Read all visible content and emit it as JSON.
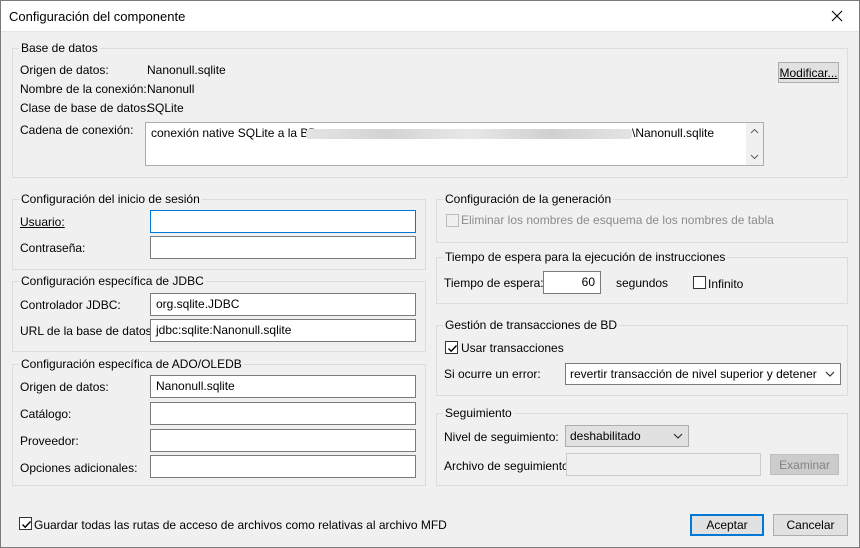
{
  "window": {
    "title": "Configuración del componente"
  },
  "db": {
    "legend": "Base de datos",
    "origin_label": "Origen de datos:",
    "origin_value": "Nanonull.sqlite",
    "conn_name_label": "Nombre de la conexión:",
    "conn_name_value": "Nanonull",
    "class_label": "Clase de base de datos:",
    "class_value": "SQLite",
    "conn_string_label": "Cadena de conexión:",
    "conn_string_prefix": "conexión native SQLite a la BD",
    "conn_string_suffix": "\\Nanonull.sqlite",
    "modify_button": "Modificar..."
  },
  "login": {
    "legend": "Configuración del inicio de sesión",
    "user_label": "Usuario:",
    "user_value": "",
    "password_label": "Contraseña:",
    "password_value": ""
  },
  "jdbc": {
    "legend": "Configuración específica de JDBC",
    "driver_label": "Controlador JDBC:",
    "driver_value": "org.sqlite.JDBC",
    "url_label": "URL de la base de datos:",
    "url_value": "jdbc:sqlite:Nanonull.sqlite"
  },
  "ado": {
    "legend": "Configuración específica de ADO/OLEDB",
    "origin_label": "Origen de datos:",
    "origin_value": "Nanonull.sqlite",
    "catalog_label": "Catálogo:",
    "catalog_value": "",
    "provider_label": "Proveedor:",
    "provider_value": "",
    "extra_label": "Opciones adicionales:",
    "extra_value": ""
  },
  "generation": {
    "legend": "Configuración de la generación",
    "strip_schema_label": "Eliminar los nombres de esquema de los nombres de tabla",
    "strip_schema_checked": false
  },
  "timeout": {
    "legend": "Tiempo de espera para la ejecución de instrucciones",
    "label": "Tiempo de espera:",
    "value": "60",
    "unit": "segundos",
    "infinite_label": "Infinito",
    "infinite_checked": false
  },
  "transactions": {
    "legend": "Gestión de transacciones de BD",
    "use_label": "Usar transacciones",
    "use_checked": true,
    "on_error_label": "Si ocurre un error:",
    "on_error_value": "revertir transacción de nivel superior y detener"
  },
  "trace": {
    "legend": "Seguimiento",
    "level_label": "Nivel de seguimiento:",
    "level_value": "deshabilitado",
    "file_label": "Archivo de seguimiento:",
    "file_value": "",
    "browse_button": "Examinar"
  },
  "footer": {
    "relative_paths_label": "Guardar todas las rutas de acceso de archivos como relativas al archivo MFD",
    "relative_paths_checked": true,
    "ok_button": "Aceptar",
    "cancel_button": "Cancelar"
  }
}
